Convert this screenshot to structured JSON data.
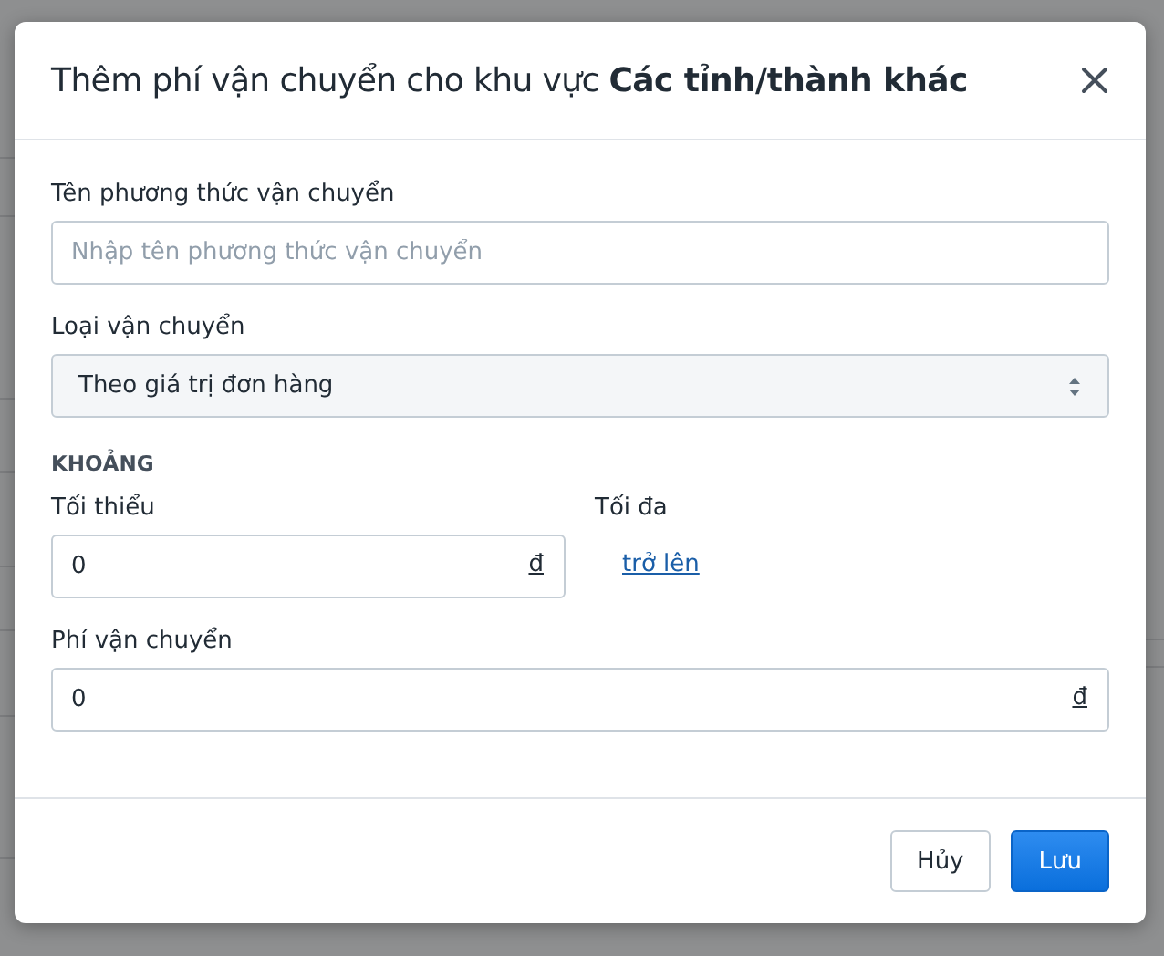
{
  "dialog": {
    "title": "Thêm phí vận chuyển cho khu vực **Các tỉnh/thành khác**",
    "name_field": {
      "label": "Tên phương thức vận chuyển",
      "placeholder": "Nhập tên phương thức vận chuyển"
    },
    "type_field": {
      "label": "Loại vận chuyển",
      "value": "Theo giá trị đơn hàng"
    },
    "range": {
      "heading": "KHOẢNG",
      "min_label": "Tối thiểu",
      "min_value": "0",
      "min_unit": "đ",
      "max_label": "Tối đa",
      "max_link": "trở lên"
    },
    "fee_field": {
      "label": "Phí vận chuyển",
      "value": "0",
      "unit": "đ"
    },
    "buttons": [
      {
        "label": "Hủy",
        "kind": "secondary"
      },
      {
        "label": "Lưu",
        "kind": "primary"
      }
    ]
  }
}
